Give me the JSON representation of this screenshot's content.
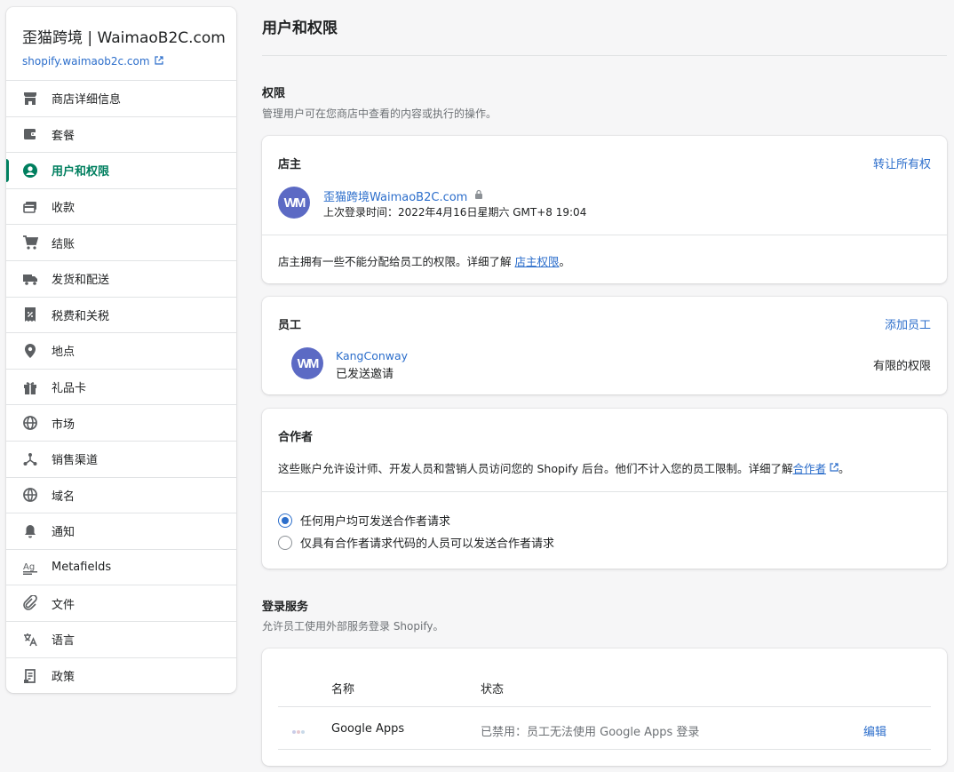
{
  "store": {
    "name": "歪猫跨境 | WaimaoB2C.com",
    "url": "shopify.waimaob2c.com"
  },
  "nav": [
    {
      "label": "商店详细信息",
      "icon": "store-icon"
    },
    {
      "label": "套餐",
      "icon": "wallet-icon"
    },
    {
      "label": "用户和权限",
      "icon": "user-icon",
      "active": true
    },
    {
      "label": "收款",
      "icon": "card-icon"
    },
    {
      "label": "结账",
      "icon": "cart-icon"
    },
    {
      "label": "发货和配送",
      "icon": "truck-icon"
    },
    {
      "label": "税费和关税",
      "icon": "tax-icon"
    },
    {
      "label": "地点",
      "icon": "location-icon"
    },
    {
      "label": "礼品卡",
      "icon": "gift-icon"
    },
    {
      "label": "市场",
      "icon": "globe-grid-icon"
    },
    {
      "label": "销售渠道",
      "icon": "channels-icon"
    },
    {
      "label": "域名",
      "icon": "globe-icon"
    },
    {
      "label": "通知",
      "icon": "bell-icon"
    },
    {
      "label": "Metafields",
      "icon": "metafields-icon"
    },
    {
      "label": "文件",
      "icon": "paperclip-icon"
    },
    {
      "label": "语言",
      "icon": "translate-icon"
    },
    {
      "label": "政策",
      "icon": "policy-icon"
    }
  ],
  "page": {
    "title": "用户和权限"
  },
  "permissions": {
    "title": "权限",
    "subtitle": "管理用户可在您商店中查看的内容或执行的操作。"
  },
  "owner_card": {
    "title": "店主",
    "action": "转让所有权",
    "avatar_text": "WM",
    "owner_name": "歪猫跨境WaimaoB2C.com",
    "last_login": "上次登录时间：2022年4月16日星期六 GMT+8 19:04",
    "note_prefix": "店主拥有一些不能分配给员工的权限。详细了解 ",
    "note_link": "店主权限",
    "note_suffix": "。"
  },
  "staff_card": {
    "title": "员工",
    "action": "添加员工",
    "avatar_text": "WM",
    "name": "KangConway",
    "status": "已发送邀请",
    "permission": "有限的权限"
  },
  "collab_card": {
    "title": "合作者",
    "desc_prefix": "这些账户允许设计师、开发人员和营销人员访问您的 Shopify 后台。他们不计入您的员工限制。详细了解 ",
    "desc_link": "合作者",
    "desc_suffix": " 。",
    "options": [
      {
        "label": "任何用户均可发送合作者请求",
        "selected": true
      },
      {
        "label": "仅具有合作者请求代码的人员可以发送合作者请求",
        "selected": false
      }
    ]
  },
  "login_services": {
    "title": "登录服务",
    "subtitle": "允许员工使用外部服务登录 Shopify。",
    "columns": [
      "名称",
      "状态"
    ],
    "rows": [
      {
        "name": "Google Apps",
        "status": "已禁用：员工无法使用 Google Apps 登录",
        "action": "编辑"
      }
    ]
  }
}
